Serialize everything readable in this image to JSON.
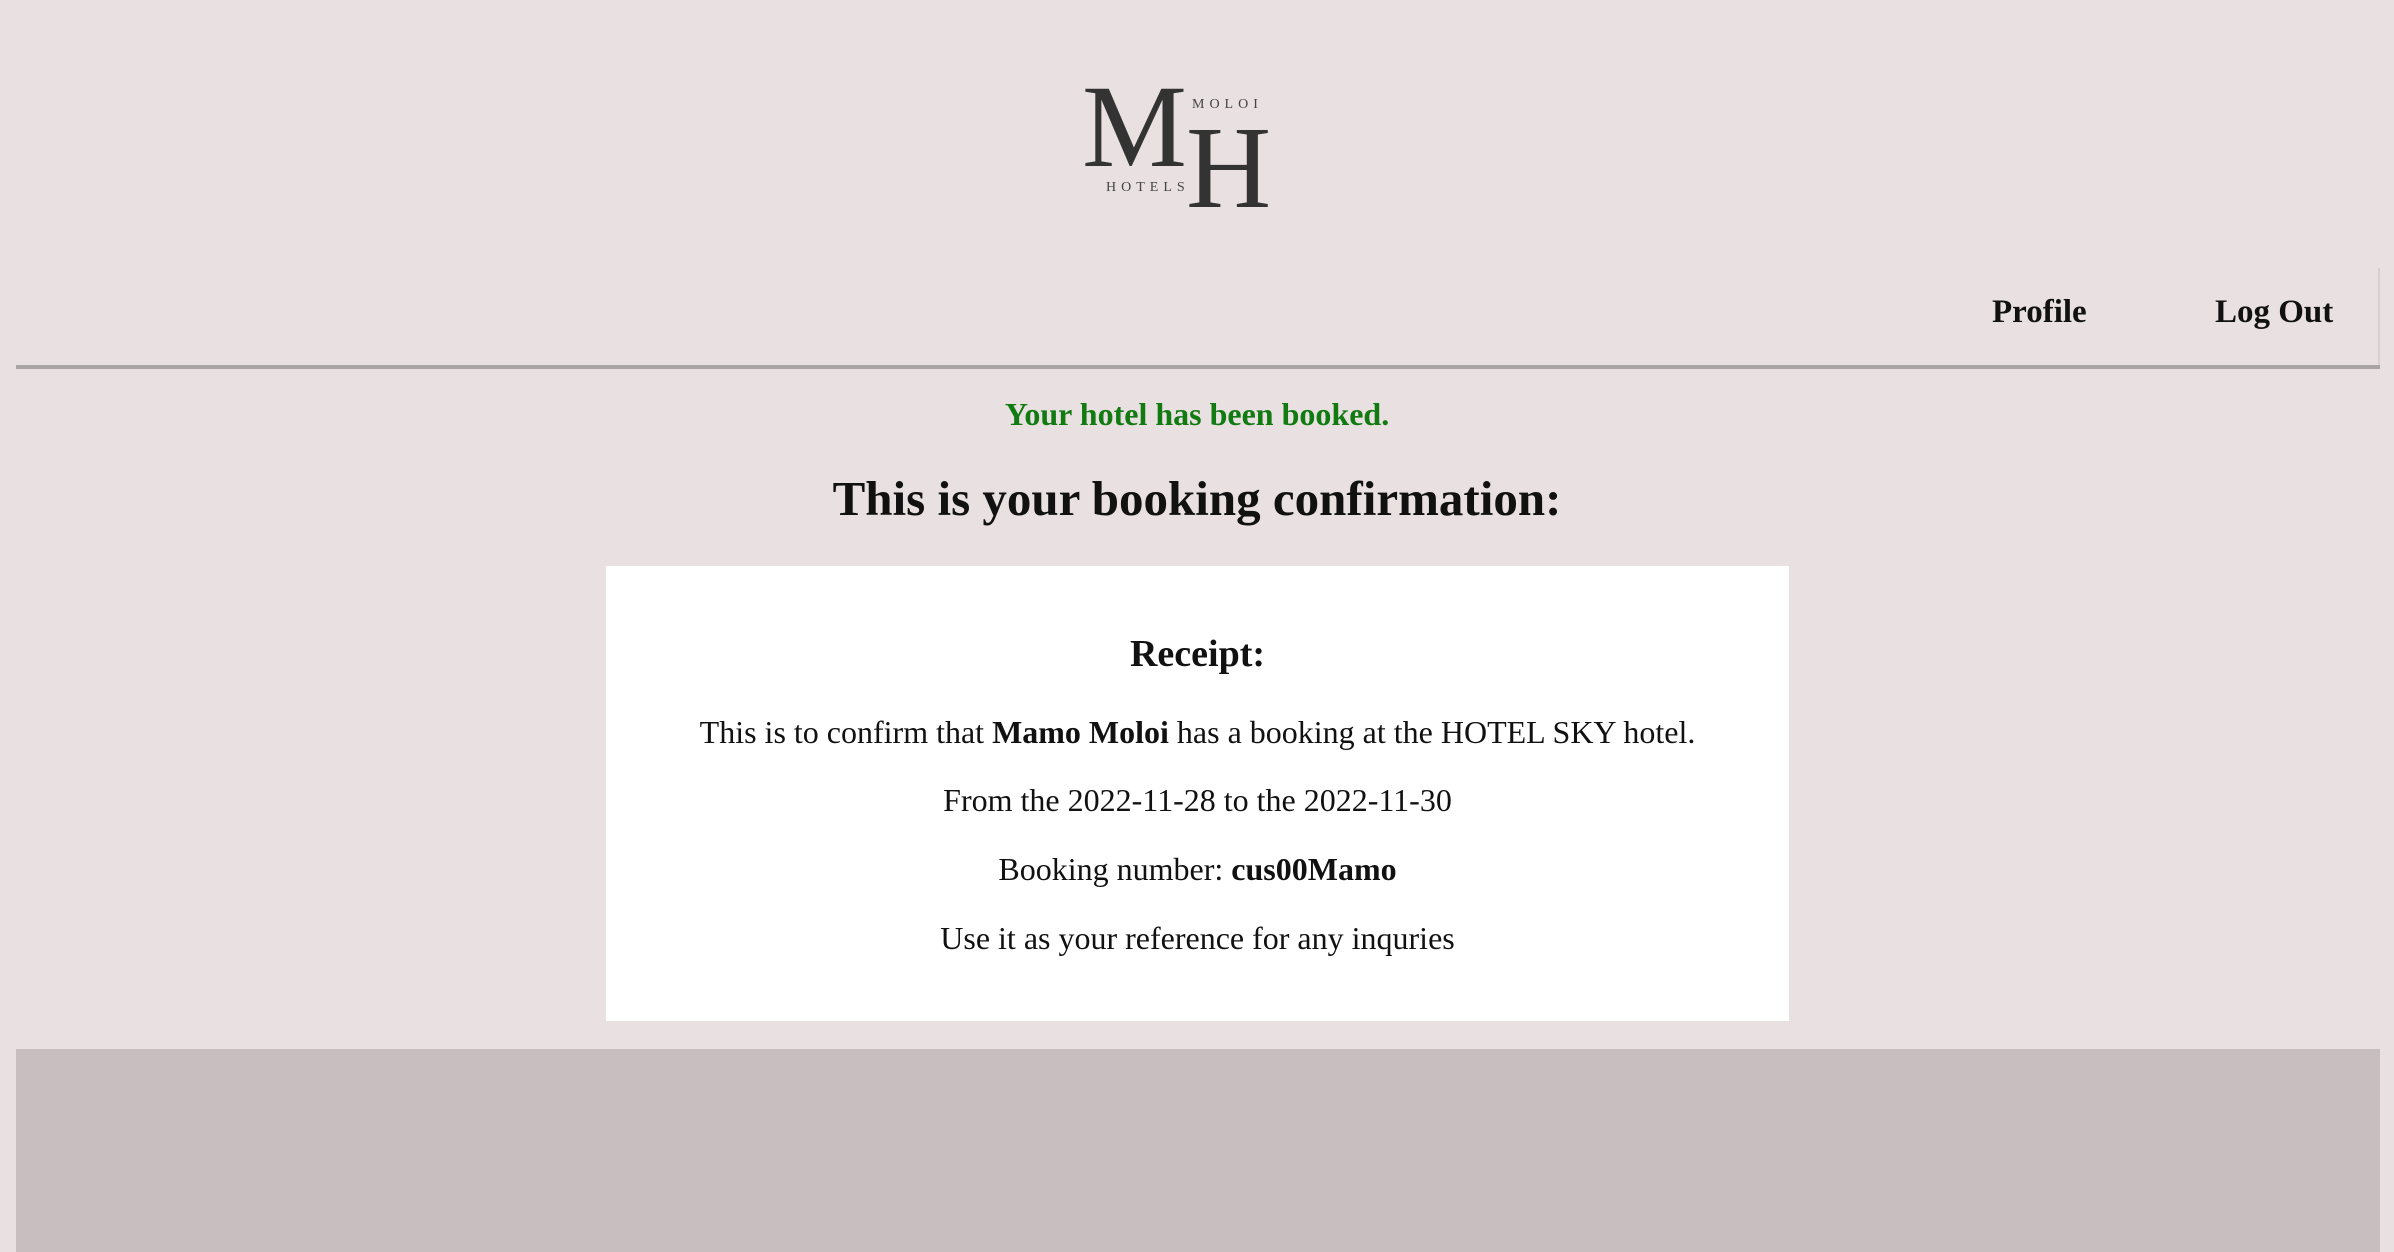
{
  "logo": {
    "letter_m": "M",
    "letter_h": "H",
    "word_top": "MOLOI",
    "word_bottom": "HOTELS"
  },
  "nav": {
    "items": [
      {
        "label": "Profile"
      },
      {
        "label": "Log Out"
      }
    ]
  },
  "status": {
    "message": "Your hotel has been booked.",
    "color": "#117a11"
  },
  "page": {
    "heading": "This is your booking confirmation:"
  },
  "receipt": {
    "title": "Receipt:",
    "confirm_prefix": "This is to confirm that ",
    "guest_name": "Mamo Moloi",
    "confirm_suffix": " has a booking at the HOTEL SKY hotel.",
    "dates_line": "From the 2022-11-28 to the 2022-11-30",
    "booking_prefix": "Booking number: ",
    "booking_number": "cus00Mamo",
    "reference_note": "Use it as your reference for any inquries"
  },
  "colors": {
    "page_background": "#e9e1e1",
    "footer_background": "#c8bebf",
    "card_background": "#ffffff"
  }
}
